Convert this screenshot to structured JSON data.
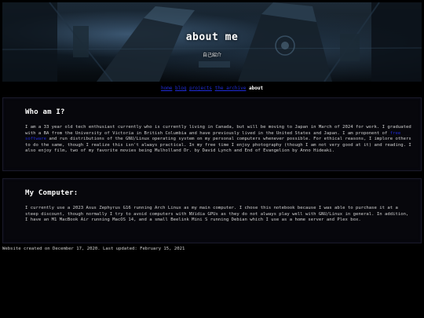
{
  "header": {
    "title": "about me",
    "subtitle": "自己紹介"
  },
  "breadcrumb": {
    "links": [
      "home",
      "blog",
      "projects",
      "the archive"
    ],
    "current": "about"
  },
  "sections": {
    "who": {
      "heading": "Who am I?",
      "text_before_link": "I am a 33 year old tech enthusiast currently who is currently living in Canada, but will be moving to Japan in March of 2024 for work. I graduated with a BA from the University of Victoria in British Columbia and have previously lived in the United States and Japan. I am proponent of ",
      "link": "free software",
      "text_after_link": " and run distributions of the GNU/Linux operating system on my personal computers whenever possible. For ethical reasons, I implore others to do the same, though I realize this isn't always practical. In my free time I enjoy photography (though I am not very good at it) and reading. I also enjoy film, two of my favorite movies being Mulholland Dr. by David Lynch and End of Evangelion by Anno Hideaki."
    },
    "computer": {
      "heading": "My Computer:",
      "text": "I currently use a 2023 Asus Zephyrus G16 running Arch Linux as my main computer. I chose this notebook because I was able to purchase it at a steep discount, though normally I try to avoid computers with NVidia GPUs as they do not always play well with GNU/Linux in general. In addition, I have an M1 MacBook Air running MacOS 14, and a small Beelink Mini S running Debian which I use as a home server and Plex box."
    }
  },
  "footer": {
    "text": "Website created on December 17, 2020. Last updated: February 15, 2021"
  },
  "colors": {
    "background": "#000000",
    "link": "#1f2bd8",
    "box": "#07070c"
  }
}
